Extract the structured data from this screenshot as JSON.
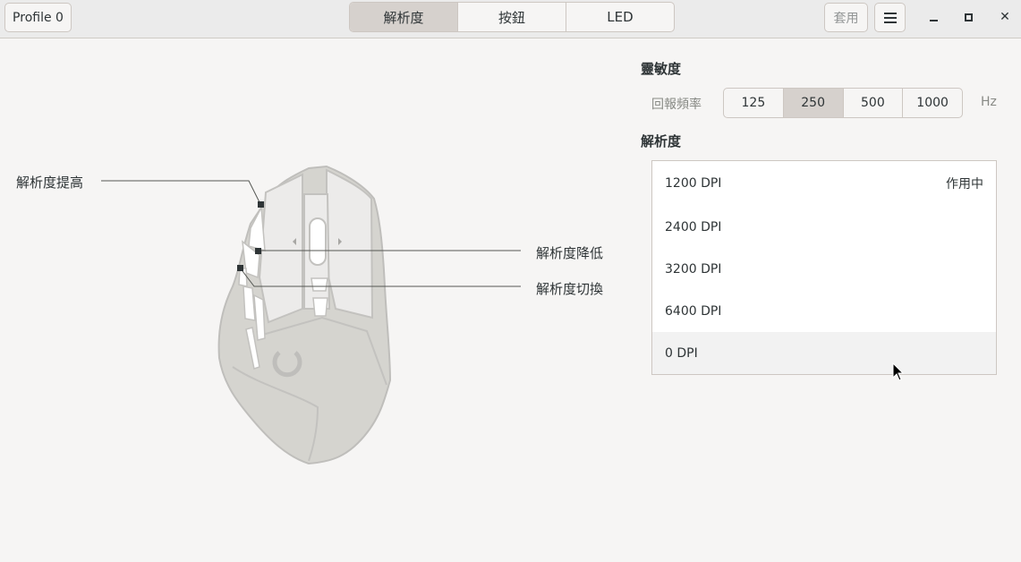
{
  "header": {
    "profile_label": "Profile 0",
    "tabs": [
      {
        "label": "解析度",
        "active": true
      },
      {
        "label": "按鈕",
        "active": false
      },
      {
        "label": "LED",
        "active": false
      }
    ],
    "apply_label": "套用"
  },
  "mouse_callouts": {
    "resolution_up": "解析度提高",
    "resolution_down": "解析度降低",
    "resolution_switch": "解析度切換"
  },
  "sensitivity": {
    "title": "靈敏度",
    "report_rate_label": "回報頻率",
    "rates": [
      {
        "label": "125",
        "active": false
      },
      {
        "label": "250",
        "active": true
      },
      {
        "label": "500",
        "active": false
      },
      {
        "label": "1000",
        "active": false
      }
    ],
    "unit": "Hz"
  },
  "resolution": {
    "title": "解析度",
    "active_tag": "作用中",
    "rows": [
      {
        "label": "1200 DPI",
        "active": true
      },
      {
        "label": "2400 DPI",
        "active": false
      },
      {
        "label": "3200 DPI",
        "active": false
      },
      {
        "label": "6400 DPI",
        "active": false
      },
      {
        "label": "0 DPI",
        "active": false,
        "hover": true
      }
    ]
  }
}
